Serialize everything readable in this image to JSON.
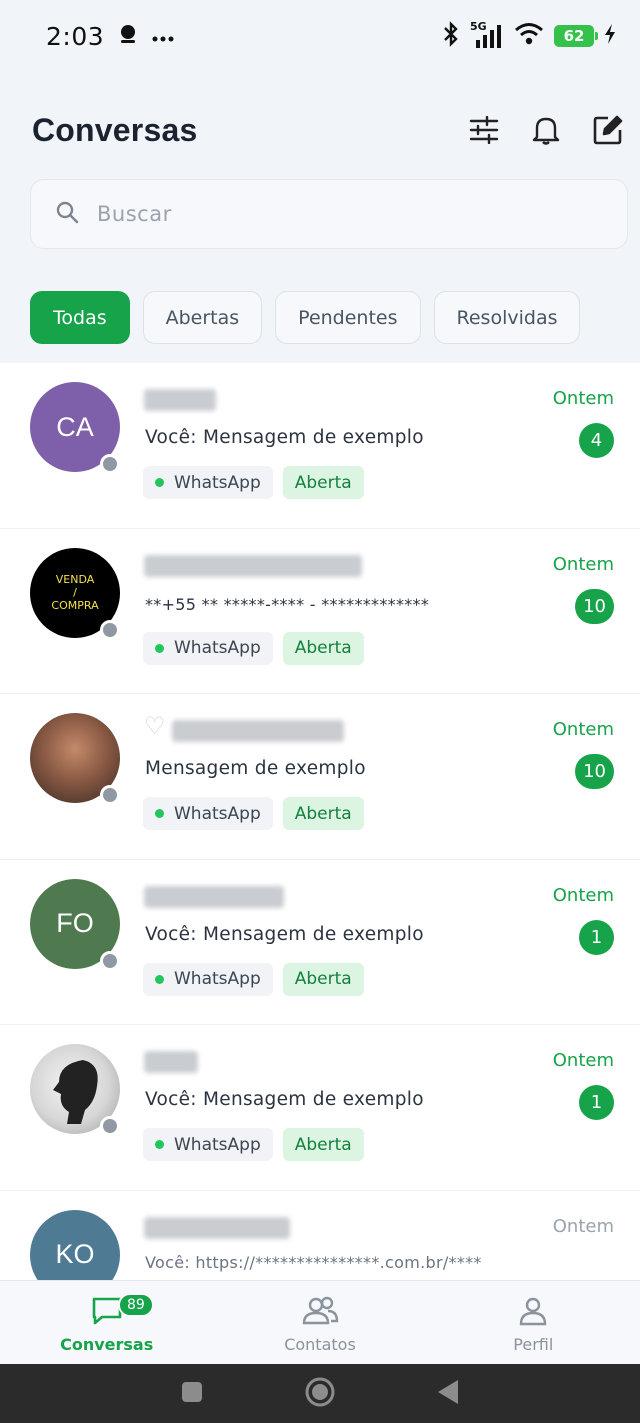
{
  "status_bar": {
    "time": "2:03",
    "battery": "62",
    "network": "5G",
    "icons": [
      "notification-icon",
      "more-icon",
      "bluetooth-icon",
      "signal-icon",
      "wifi-icon",
      "charging-icon"
    ]
  },
  "header": {
    "title": "Conversas",
    "actions": [
      "filter-sliders-icon",
      "bell-icon",
      "compose-icon"
    ]
  },
  "search": {
    "placeholder": "Buscar"
  },
  "filters": [
    {
      "label": "Todas",
      "active": true
    },
    {
      "label": "Abertas",
      "active": false
    },
    {
      "label": "Pendentes",
      "active": false
    },
    {
      "label": "Resolvidas",
      "active": false
    }
  ],
  "conversations": [
    {
      "initials": "CA",
      "avatar_color": "#7e5fa9",
      "preview": "Você: Mensagem de exemplo",
      "channel": "WhatsApp",
      "status": "Aberta",
      "time": "Ontem",
      "unread": "4"
    },
    {
      "avatar_text": [
        "VENDA",
        "/",
        "COMPRA"
      ],
      "avatar_color": "#000000",
      "preview": "**+55 ** *****-**** - *************",
      "channel": "WhatsApp",
      "status": "Aberta",
      "time": "Ontem",
      "unread": "10"
    },
    {
      "avatar_color": "#6b4a3a",
      "preview": "Mensagem de exemplo",
      "channel": "WhatsApp",
      "status": "Aberta",
      "time": "Ontem",
      "unread": "10"
    },
    {
      "initials": "FO",
      "avatar_color": "#4f7a4f",
      "preview": "Você: Mensagem de exemplo",
      "channel": "WhatsApp",
      "status": "Aberta",
      "time": "Ontem",
      "unread": "1"
    },
    {
      "avatar_color": "#d8d8d8",
      "preview": "Você: Mensagem de exemplo",
      "channel": "WhatsApp",
      "status": "Aberta",
      "time": "Ontem",
      "unread": "1"
    },
    {
      "initials": "KO",
      "avatar_color": "#4f7a94",
      "preview": "Você: https://***************.com.br/****",
      "time": "Ontem"
    }
  ],
  "bottom_nav": [
    {
      "label": "Conversas",
      "icon": "chat-icon",
      "badge": "89",
      "active": true
    },
    {
      "label": "Contatos",
      "icon": "contacts-icon",
      "active": false
    },
    {
      "label": "Perfil",
      "icon": "profile-icon",
      "active": false
    }
  ],
  "colors": {
    "accent": "#16a34a",
    "tag_bg": "#dcf5e3"
  }
}
